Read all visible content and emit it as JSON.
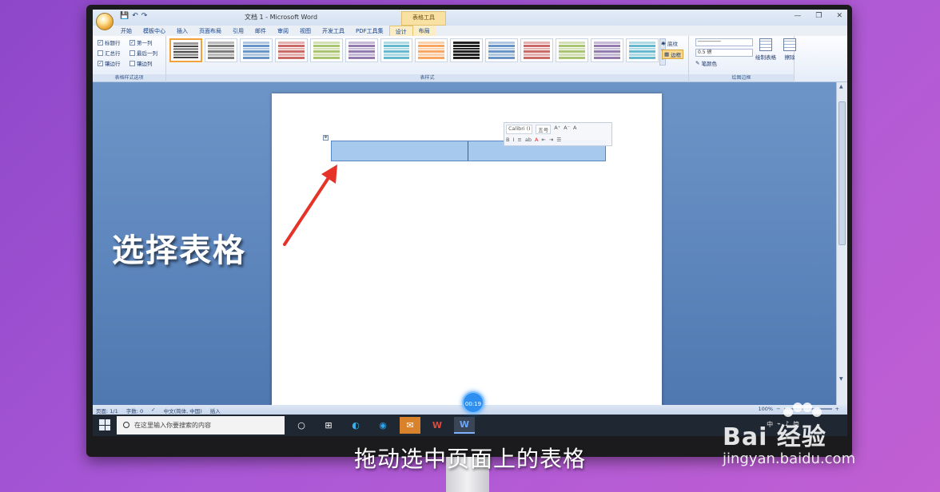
{
  "window": {
    "title": "文档 1 - Microsoft Word",
    "context_tool_label": "表格工具",
    "quick_access": [
      "💾",
      "↶",
      "↷"
    ]
  },
  "tabs": [
    {
      "label": "开始"
    },
    {
      "label": "模板中心"
    },
    {
      "label": "插入"
    },
    {
      "label": "页面布局"
    },
    {
      "label": "引用"
    },
    {
      "label": "邮件"
    },
    {
      "label": "审阅"
    },
    {
      "label": "视图"
    },
    {
      "label": "开发工具"
    },
    {
      "label": "PDF工具集"
    },
    {
      "label": "设计"
    },
    {
      "label": "布局"
    }
  ],
  "ribbon": {
    "style_options": {
      "group_label": "表格样式选项",
      "options": [
        {
          "label": "标题行",
          "checked": true
        },
        {
          "label": "第一列",
          "checked": true
        },
        {
          "label": "汇总行",
          "checked": false
        },
        {
          "label": "最后一列",
          "checked": false
        },
        {
          "label": "镶边行",
          "checked": true
        },
        {
          "label": "镶边列",
          "checked": false
        }
      ]
    },
    "table_styles": {
      "group_label": "表样式",
      "swatch_colors": [
        "#222222",
        "#666666",
        "#4f81bd",
        "#c0504d",
        "#9bbb59",
        "#8064a2",
        "#4bacc6",
        "#f79646",
        "#000000",
        "#4f81bd",
        "#c0504d",
        "#9bbb59",
        "#8064a2",
        "#4bacc6"
      ]
    },
    "shading_label": "底纹",
    "borders_label": "边框",
    "draw_borders": {
      "group_label": "绘图边框",
      "line_weight": "0.5 磅",
      "pen_color_label": "笔颜色",
      "draw_table_label": "绘制表格",
      "eraser_label": "擦除"
    }
  },
  "mini_toolbar": {
    "font": "Calibri (I",
    "size": "五号",
    "row2": [
      "B",
      "I",
      "≡",
      "ab",
      "A",
      "⇤",
      "⇥",
      "☰"
    ]
  },
  "overlay_caption": "选择表格",
  "status": {
    "page": "页面: 1/1",
    "words": "字数: 0",
    "language": "中文(简体, 中国)",
    "mode": "插入",
    "zoom": "100%"
  },
  "taskbar": {
    "search_placeholder": "在这里输入你要搜索的内容",
    "tray": [
      "中",
      "简"
    ]
  },
  "video": {
    "timer": "00:19",
    "subtitle": "拖动选中页面上的表格"
  },
  "watermark": {
    "logo_text": "Bai 经验",
    "url": "jingyan.baidu.com"
  },
  "colors": {
    "selection": "#a7c9ee",
    "ribbon_active_tab": "#fff7de",
    "doc_background": "#5d86bd"
  }
}
